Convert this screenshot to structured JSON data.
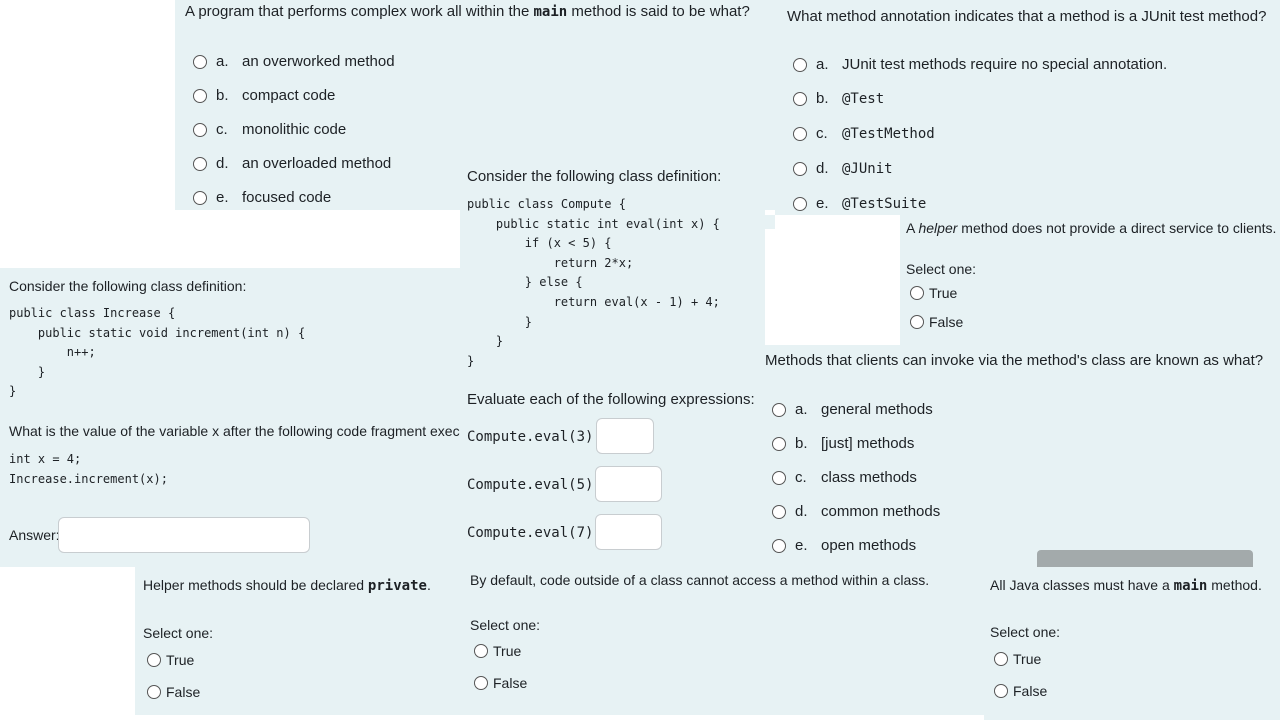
{
  "q1": {
    "text_before": "A program that performs complex work all within the ",
    "code": "main",
    "text_after": " method is said to be what?",
    "options": [
      {
        "letter": "a.",
        "text": "an overworked method"
      },
      {
        "letter": "b.",
        "text": "compact code"
      },
      {
        "letter": "c.",
        "text": "monolithic code"
      },
      {
        "letter": "d.",
        "text": "an overloaded method"
      },
      {
        "letter": "e.",
        "text": "focused code"
      }
    ]
  },
  "q2": {
    "text": "What method annotation indicates that a method is a JUnit test method?",
    "options": [
      {
        "letter": "a.",
        "text": "JUnit test methods require no special annotation."
      },
      {
        "letter": "b.",
        "text": "@Test"
      },
      {
        "letter": "c.",
        "text": "@TestMethod"
      },
      {
        "letter": "d.",
        "text": "@JUnit"
      },
      {
        "letter": "e.",
        "text": "@TestSuite"
      }
    ]
  },
  "q3": {
    "intro": "Consider the following class definition:",
    "code": "public class Compute {\n    public static int eval(int x) {\n        if (x < 5) {\n            return 2*x;\n        } else {\n            return eval(x - 1) + 4;\n        }\n    }\n}",
    "prompt": "Evaluate each of the following expressions:",
    "expressions": [
      "Compute.eval(3)",
      "Compute.eval(5)",
      "Compute.eval(7)"
    ],
    "answers": [
      "",
      "",
      ""
    ]
  },
  "q4": {
    "text_a": "A ",
    "text_em": "helper",
    "text_b": " method does not provide a direct service to clients.",
    "select": "Select one:",
    "true": "True",
    "false": "False"
  },
  "q5": {
    "text": "Methods that clients can invoke via the method's class are known as what?",
    "options": [
      {
        "letter": "a.",
        "text": "general methods"
      },
      {
        "letter": "b.",
        "text": "[just] methods"
      },
      {
        "letter": "c.",
        "text": "class methods"
      },
      {
        "letter": "d.",
        "text": "common methods"
      },
      {
        "letter": "e.",
        "text": "open methods"
      }
    ]
  },
  "q6": {
    "intro": "Consider the following class definition:",
    "code": "public class Increase {\n    public static void increment(int n) {\n        n++;\n    }\n}",
    "prompt": "What is the value of the variable x after the following code fragment executes?",
    "fragment": "int x = 4;\nIncrease.increment(x);",
    "answer_label": "Answer:",
    "answer": ""
  },
  "q7": {
    "text": "Helper methods should be declared ",
    "code": "private",
    "text_after": ".",
    "select": "Select one:",
    "true": "True",
    "false": "False"
  },
  "q8": {
    "text": "By default, code outside of a class cannot access a method within a class.",
    "select": "Select one:",
    "true": "True",
    "false": "False"
  },
  "q9": {
    "text": "All Java classes must have a ",
    "code": "main",
    "text_after": " method.",
    "select": "Select one:",
    "true": "True",
    "false": "False"
  }
}
